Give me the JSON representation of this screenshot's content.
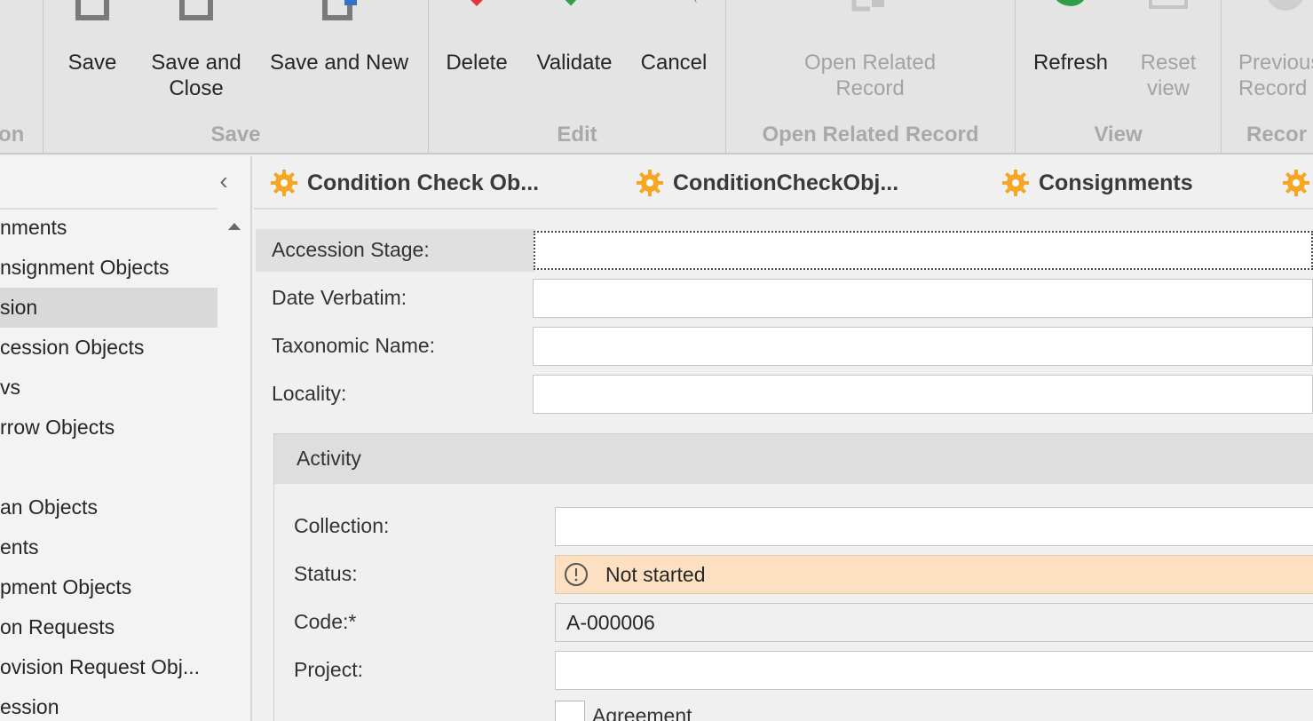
{
  "ribbon": {
    "groups": {
      "partial_left": "on",
      "save": "Save",
      "edit": "Edit",
      "open_related": "Open Related Record",
      "view": "View",
      "records_partial": "Recor"
    },
    "buttons": {
      "save": "Save",
      "save_and_close": "Save and\nClose",
      "save_and_new": "Save and New",
      "delete": "Delete",
      "validate": "Validate",
      "cancel": "Cancel",
      "open_related_record": "Open Related\nRecord",
      "refresh": "Refresh",
      "reset_view": "Reset\nview",
      "previous_record": "Previous\nRecord"
    }
  },
  "nav": {
    "collapse_glyph": "‹",
    "items": [
      {
        "label": "nments"
      },
      {
        "label": "nsignment Objects"
      },
      {
        "label": "sion"
      },
      {
        "label": "cession Objects"
      },
      {
        "label": "vs"
      },
      {
        "label": "rrow Objects"
      },
      {
        "label": ""
      },
      {
        "label": "an Objects"
      },
      {
        "label": "ents"
      },
      {
        "label": "pment Objects"
      },
      {
        "label": "on Requests"
      },
      {
        "label": "ovision Request Obj..."
      },
      {
        "label": "ession"
      }
    ]
  },
  "tabs": [
    {
      "label": "Condition Check Ob..."
    },
    {
      "label": "ConditionCheckObj..."
    },
    {
      "label": "Consignments"
    }
  ],
  "form": {
    "accession_stage": {
      "label": "Accession Stage:",
      "value": ""
    },
    "date_verbatim": {
      "label": "Date Verbatim:",
      "value": ""
    },
    "taxonomic_name": {
      "label": "Taxonomic Name:",
      "value": ""
    },
    "locality": {
      "label": "Locality:",
      "value": ""
    },
    "activity": {
      "title": "Activity",
      "collection": {
        "label": "Collection:",
        "value": ""
      },
      "status": {
        "label": "Status:",
        "value": "Not started"
      },
      "code": {
        "label": "Code:*",
        "value": "A-000006"
      },
      "project": {
        "label": "Project:",
        "value": ""
      },
      "agreement": {
        "label": "Agreement"
      }
    }
  },
  "colors": {
    "ribbon_bg": "#e4e4e4",
    "delete_red": "#e5343e",
    "validate_green": "#2f9e48",
    "cancel_blue": "#2f72c8",
    "gear_orange": "#f5a623",
    "status_bg": "#fde0c2"
  }
}
